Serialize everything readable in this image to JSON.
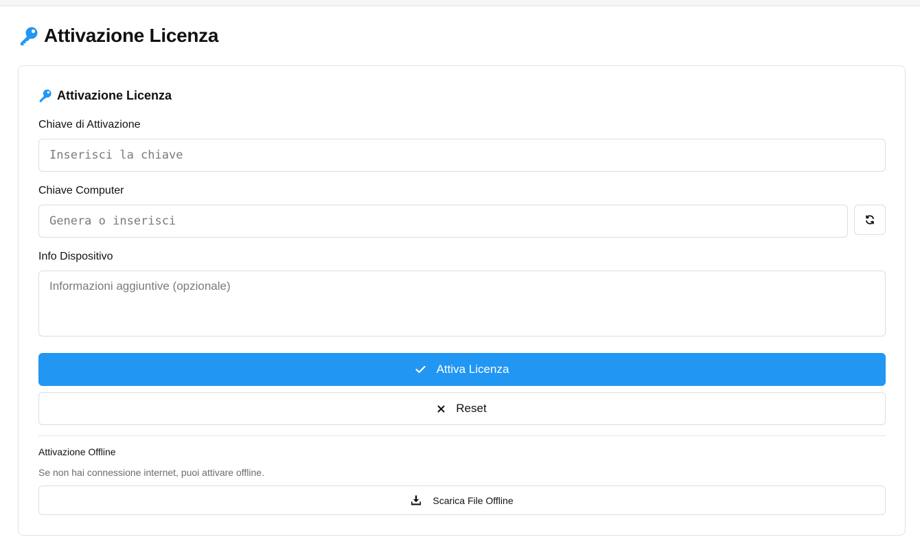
{
  "header": {
    "title": "Attivazione Licenza",
    "icon": "key-icon"
  },
  "card": {
    "title": "Attivazione Licenza",
    "icon": "key-icon",
    "activation_key": {
      "label": "Chiave di Attivazione",
      "placeholder": "Inserisci la chiave",
      "value": ""
    },
    "computer_key": {
      "label": "Chiave Computer",
      "placeholder": "Genera o inserisci",
      "value": "",
      "generate_icon": "refresh-icon"
    },
    "device_info": {
      "label": "Info Dispositivo",
      "placeholder": "Informazioni aggiuntive (opzionale)",
      "value": ""
    },
    "activate_button": {
      "label": "Attiva Licenza",
      "icon": "check-icon"
    },
    "reset_button": {
      "label": "Reset",
      "icon": "close-icon"
    },
    "offline": {
      "title": "Attivazione Offline",
      "description": "Se non hai connessione internet, puoi attivare offline.",
      "download_button": {
        "label": "Scarica File Offline",
        "icon": "download-icon"
      }
    }
  },
  "colors": {
    "primary": "#2196f3",
    "key_icon": "#2196f3",
    "border": "#dcdde1"
  }
}
